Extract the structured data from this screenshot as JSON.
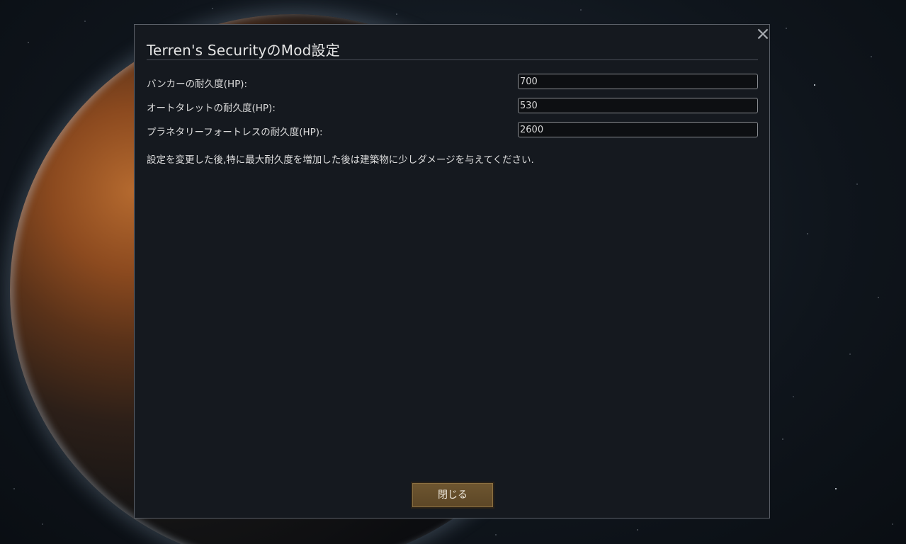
{
  "dialog": {
    "title": "Terren's SecurityのMod設定",
    "close_icon": "×",
    "fields": [
      {
        "label": "バンカーの耐久度(HP):",
        "value": "700"
      },
      {
        "label": "オートタレットの耐久度(HP):",
        "value": "530"
      },
      {
        "label": "プラネタリーフォートレスの耐久度(HP):",
        "value": "2600"
      }
    ],
    "note": "設定を変更した後,特に最大耐久度を増加した後は建築物に少しダメージを与えてください.",
    "close_button_label": "閉じる"
  }
}
